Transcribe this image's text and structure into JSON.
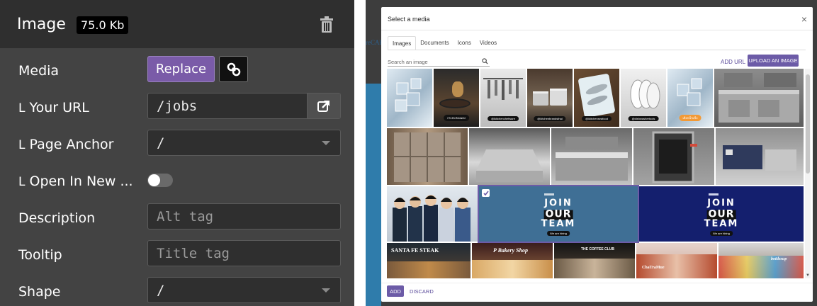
{
  "panel": {
    "title": "Image",
    "size_badge": "75.0 Kb",
    "media_label": "Media",
    "replace_label": "Replace",
    "url_prefix": "L",
    "url_label": "Your URL",
    "url_value": "/jobs",
    "anchor_prefix": "L",
    "anchor_label": "Page Anchor",
    "anchor_value": "/",
    "newtab_prefix": "L",
    "newtab_label": "Open In New ...",
    "newtab_on": false,
    "description_label": "Description",
    "description_placeholder": "Alt tag",
    "tooltip_label": "Tooltip",
    "tooltip_placeholder": "Title tag",
    "shape_label": "Shape",
    "shape_value": "/"
  },
  "background": {
    "partial_text": "reCAP"
  },
  "modal": {
    "title": "Select a media",
    "close_glyph": "×",
    "tabs": [
      "Images",
      "Documents",
      "Icons",
      "Videos"
    ],
    "active_tab": "Images",
    "search_placeholder": "Search an image",
    "add_url_label": "ADD URL",
    "upload_label": "UPLOAD AN IMAGE",
    "add_label": "ADD",
    "discard_label": "DISCARD",
    "images": [
      {
        "subject": "ice cubes",
        "caption": ""
      },
      {
        "subject": "cooking with pan",
        "caption": "กระทะทองแดง"
      },
      {
        "subject": "hanging kitchen utensils",
        "caption": "@ikitchenchefware"
      },
      {
        "subject": "stainless pots",
        "caption": "@kitchenbrandsthai"
      },
      {
        "subject": "fish on ice",
        "caption": "@ikitchenseafood"
      },
      {
        "subject": "dishwashing plates",
        "caption": "@dishwashertools"
      },
      {
        "subject": "ice cubes selected",
        "caption": "เลือกน้ำแข็ง"
      },
      {
        "subject": "commercial kitchen",
        "caption": ""
      },
      {
        "subject": "stainless fridges",
        "caption": ""
      },
      {
        "subject": "stainless counter",
        "caption": ""
      },
      {
        "subject": "stainless kitchen room",
        "caption": ""
      },
      {
        "subject": "combi oven",
        "caption": ""
      },
      {
        "subject": "coffee machine",
        "caption": ""
      },
      {
        "subject": "team photo",
        "caption": ""
      },
      {
        "subject": "join our team blue",
        "caption": "",
        "selected": true
      },
      {
        "subject": "join our team navy",
        "caption": ""
      },
      {
        "subject": "santa fe steak store",
        "caption": ""
      },
      {
        "subject": "bakery shop",
        "caption": ""
      },
      {
        "subject": "coffee club",
        "caption": ""
      },
      {
        "subject": "chatime store",
        "caption": ""
      },
      {
        "subject": "bottle store",
        "caption": ""
      }
    ],
    "join_line1": "JOIN",
    "join_line2": "OUR",
    "join_line3": "TEAM",
    "join_hiring": "We are hiring",
    "store_santa": "SANTA FE STEAK",
    "store_bakery": "P Bakery Shop",
    "store_coffee": "THE COFFEE CLUB",
    "store_chatime": "ChaTraMue",
    "store_bottle": "bottlesup",
    "colors": {
      "accent": "#6c5ba7",
      "replace": "#7a5ba8",
      "join_blue": "#3f6f95",
      "join_navy": "#141f6e"
    }
  }
}
